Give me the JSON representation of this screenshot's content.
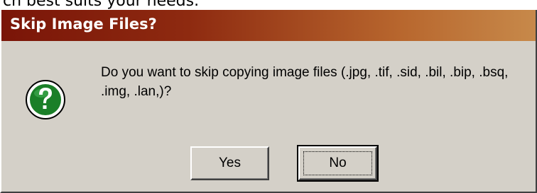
{
  "background_text": "ch best suits your needs.",
  "dialog": {
    "title": "Skip Image Files?",
    "icon": "question-icon",
    "message": "Do you want to skip copying image files (.jpg, .tif, .sid, .bil, .bip, .bsq, .img, .lan,)?",
    "buttons": {
      "yes_label": "Yes",
      "no_label": "No",
      "default": "No"
    }
  },
  "colors": {
    "titlebar_start": "#7a1508",
    "titlebar_end": "#c7894a",
    "dialog_face": "#d4d0c8",
    "icon_green": "#1a7f28"
  }
}
